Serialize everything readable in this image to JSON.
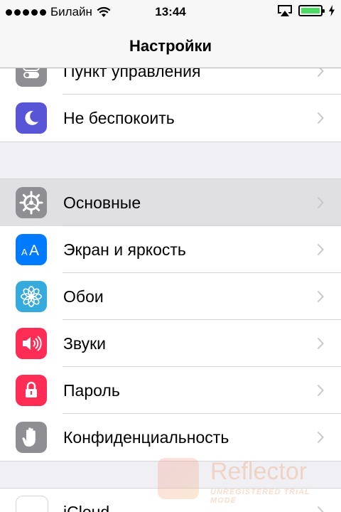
{
  "status_bar": {
    "carrier": "Билайн",
    "time": "13:44",
    "battery_color": "#4cd964"
  },
  "nav": {
    "title": "Настройки"
  },
  "groups": [
    {
      "items": [
        {
          "label": "Пункт управления",
          "icon": "control-center-icon",
          "color": "#8e8e93"
        },
        {
          "label": "Не беспокоить",
          "icon": "moon-icon",
          "color": "#5856d6"
        }
      ]
    },
    {
      "items": [
        {
          "label": "Основные",
          "icon": "gear-icon",
          "color": "#8e8e93",
          "selected": true
        },
        {
          "label": "Экран и яркость",
          "icon": "text-size-icon",
          "color": "#007aff"
        },
        {
          "label": "Обои",
          "icon": "flower-icon",
          "color": "#35aadc"
        },
        {
          "label": "Звуки",
          "icon": "speaker-icon",
          "color": "#ff2d55"
        },
        {
          "label": "Пароль",
          "icon": "lock-icon",
          "color": "#ff2d55"
        },
        {
          "label": "Конфиденциальность",
          "icon": "hand-icon",
          "color": "#8e8e93"
        }
      ]
    },
    {
      "items": [
        {
          "label": "iCloud",
          "icon": "cloud-icon",
          "color": "#ffffff"
        }
      ]
    }
  ],
  "watermark": {
    "name": "Reflector",
    "subtitle": "UNREGISTERED TRIAL MODE"
  }
}
